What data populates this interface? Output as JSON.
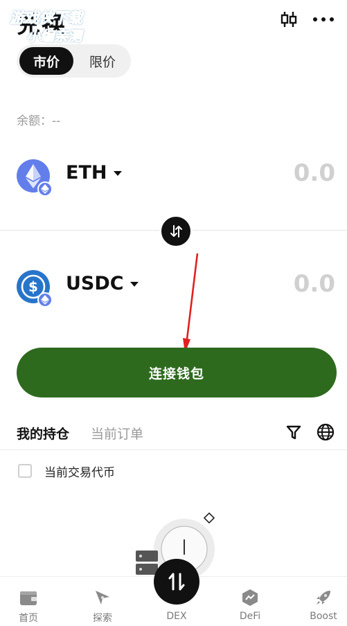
{
  "header": {
    "title": "兑换",
    "watermark_line1": "游戏侠下载",
    "watermark_line2": "小编亲测",
    "chart_icon": "candlestick-icon",
    "more_icon": "more-dots-icon"
  },
  "order_type": {
    "market_label": "市价",
    "limit_label": "限价",
    "selected": "市价"
  },
  "balance_text": "余额：--",
  "from_token": {
    "symbol": "ETH",
    "amount": "0.0",
    "icon": "eth-icon",
    "chain_icon": "eth-chain-badge-icon"
  },
  "to_token": {
    "symbol": "USDC",
    "amount": "0.0",
    "icon": "usdc-icon",
    "chain_icon": "eth-chain-badge-icon"
  },
  "swap_icon": "swap-direction-icon",
  "connect_button": "连接钱包",
  "tabs": {
    "holdings": "我的持仓",
    "orders": "当前订单",
    "selected": "我的持仓",
    "filter_icon": "filter-icon",
    "network_icon": "globe-icon"
  },
  "current_token_filter": {
    "label": "当前交易代币",
    "checked": false
  },
  "nav": [
    {
      "label": "首页",
      "icon": "wallet-icon"
    },
    {
      "label": "探索",
      "icon": "compass-icon"
    },
    {
      "label": "DEX",
      "icon": "swap-vertical-icon"
    },
    {
      "label": "DeFi",
      "icon": "defi-chart-icon"
    },
    {
      "label": "Boost",
      "icon": "rocket-icon"
    }
  ],
  "colors": {
    "accent_green": "#2d6a1e",
    "eth_blue": "#627eea",
    "usdc_blue": "#2775ca",
    "muted_text": "#9a9a9a"
  }
}
